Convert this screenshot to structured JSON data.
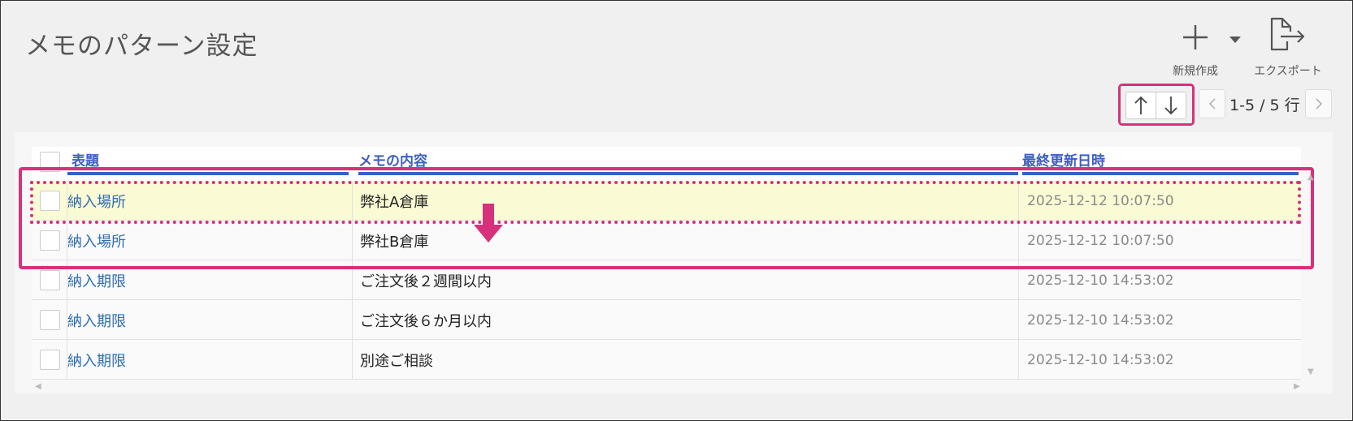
{
  "header": {
    "title": "メモのパターン設定"
  },
  "toolbar": {
    "new_label": "新規作成",
    "export_label": "エクスポート",
    "new_icon": "plus-icon",
    "dropdown_icon": "caret-down-icon",
    "export_icon": "export-icon"
  },
  "pager": {
    "range": "1-5 / 5 行",
    "up_icon": "arrow-up-icon",
    "down_icon": "arrow-down-icon",
    "prev_icon": "chevron-left-icon",
    "next_icon": "chevron-right-icon"
  },
  "table": {
    "columns": [
      "表題",
      "メモの内容",
      "最終更新日時"
    ],
    "rows": [
      {
        "title": "納入場所",
        "content": "弊社A倉庫",
        "updated": "2025-12-12 10:07:50",
        "highlighted": true
      },
      {
        "title": "納入場所",
        "content": "弊社B倉庫",
        "updated": "2025-12-12 10:07:50",
        "highlighted": false
      },
      {
        "title": "納入期限",
        "content": "ご注文後２週間以内",
        "updated": "2025-12-10 14:53:02",
        "highlighted": false
      },
      {
        "title": "納入期限",
        "content": "ご注文後６か月以内",
        "updated": "2025-12-10 14:53:02",
        "highlighted": false
      },
      {
        "title": "納入期限",
        "content": "別途ご相談",
        "updated": "2025-12-10 14:53:02",
        "highlighted": false
      }
    ]
  },
  "colors": {
    "accent": "#d6317a",
    "header_link": "#3b5fc4",
    "row_link": "#2f6db2",
    "highlight_row": "#fafbd4"
  }
}
